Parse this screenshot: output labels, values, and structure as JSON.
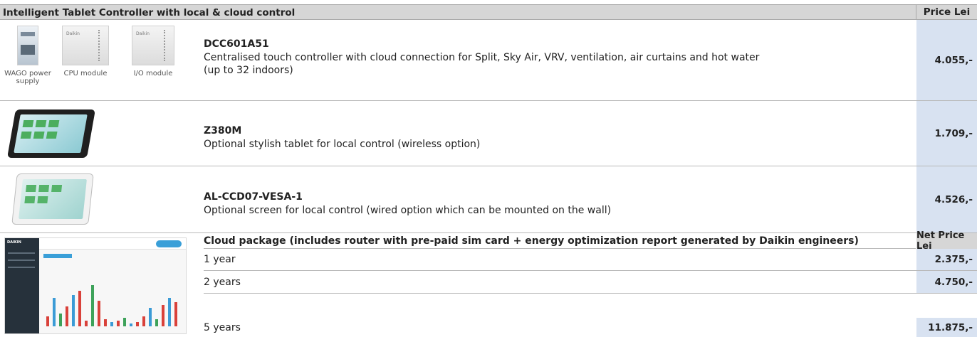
{
  "header": {
    "title": "Intelligent Tablet Controller with local & cloud control",
    "price_label": "Price Lei"
  },
  "products": [
    {
      "code": "DCC601A51",
      "lines": [
        "Centralised touch controller with cloud connection for Split, Sky Air, VRV, ventilation, air curtains and hot water",
        "(up to 32 indoors)"
      ],
      "price": "4.055,-",
      "modules": [
        "WAGO power supply",
        "CPU module",
        "I/O module"
      ],
      "module_brand": "Daikin"
    },
    {
      "code": "Z380M",
      "lines": [
        "Optional stylish tablet for local control (wireless option)"
      ],
      "price": "1.709,-"
    },
    {
      "code": "AL-CCD07-VESA-1",
      "lines": [
        "Optional screen for local control (wired option which can be mounted on the wall)"
      ],
      "price": "4.526,-"
    }
  ],
  "cloud": {
    "title": "Cloud package (includes router with pre-paid sim card + energy optimization report generated by Daikin engineers)",
    "price_label": "Net Price Lei",
    "dashboard_brand": "DAIKIN",
    "options": [
      {
        "label": "1 year",
        "price": "2.375,-"
      },
      {
        "label": "2 years",
        "price": "4.750,-"
      },
      {
        "label": "5 years",
        "price": "11.875,-"
      }
    ]
  },
  "colors": {
    "header_bg": "#d6d6d6",
    "price_bg": "#d8e2f1",
    "bar_red": "#d9413a",
    "bar_blue": "#3b9bd6",
    "bar_green": "#3ea25a"
  }
}
